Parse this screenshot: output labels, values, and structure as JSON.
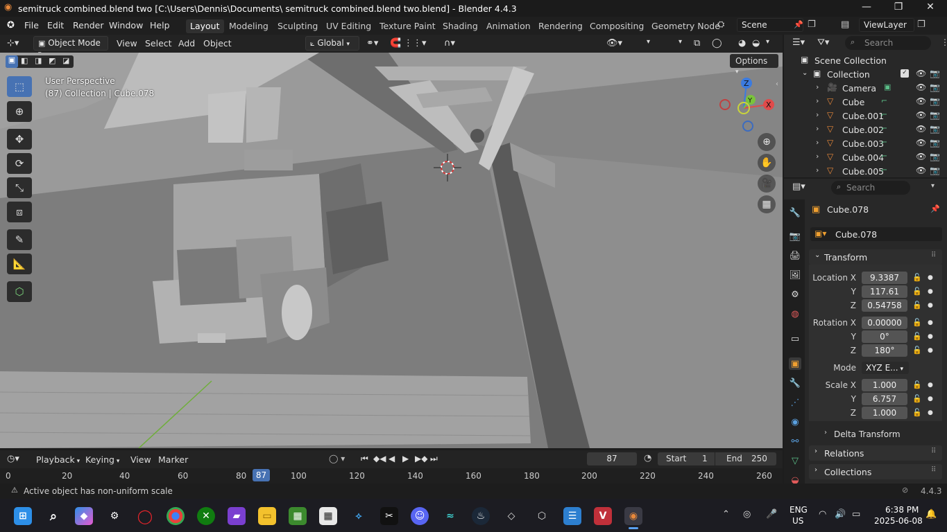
{
  "window": {
    "title": "semitruck combined.blend two [C:\\Users\\Dennis\\Documents\\ semitruck combined.blend two.blend] - Blender 4.4.3",
    "minimize": "—",
    "maximize": "❐",
    "close": "✕"
  },
  "menu": {
    "file": "File",
    "edit": "Edit",
    "render": "Render",
    "window": "Window",
    "help": "Help"
  },
  "workspaces": [
    "Layout",
    "Modeling",
    "Sculpting",
    "UV Editing",
    "Texture Paint",
    "Shading",
    "Animation",
    "Rendering",
    "Compositing",
    "Geometry Node"
  ],
  "scene": {
    "name": "Scene",
    "view_layer": "ViewLayer"
  },
  "viewport_header": {
    "mode": "Object Mode",
    "view": "View",
    "select": "Select",
    "add": "Add",
    "object": "Object",
    "orientation": "Global",
    "options": "Options"
  },
  "viewport": {
    "perspective": "User Perspective",
    "collection_info": "(87) Collection | Cube.078",
    "gizmo": {
      "z": "Z",
      "y": "Y",
      "x": "X"
    }
  },
  "outliner": {
    "search_placeholder": "Search",
    "root": "Scene Collection",
    "collection": "Collection",
    "items": [
      "Camera",
      "Cube",
      "Cube.001",
      "Cube.002",
      "Cube.003",
      "Cube.004",
      "Cube.005"
    ]
  },
  "properties": {
    "search_placeholder": "Search",
    "object_name": "Cube.078",
    "datablock_name": "Cube.078",
    "transform_title": "Transform",
    "location_label": "Location X",
    "rotation_label": "Rotation X",
    "scale_label": "Scale X",
    "y_label": "Y",
    "z_label": "Z",
    "mode_label": "Mode",
    "location": [
      "9.3387",
      "117.61",
      "0.54758"
    ],
    "rotation": [
      "0.00000",
      "0°",
      "180°"
    ],
    "mode": "XYZ E...",
    "scale": [
      "1.000",
      "6.757",
      "1.000"
    ],
    "delta_transform": "Delta Transform",
    "relations": "Relations",
    "collections": "Collections"
  },
  "timeline": {
    "playback": "Playback",
    "keying": "Keying",
    "view": "View",
    "marker": "Marker",
    "current_frame": "87",
    "start_label": "Start",
    "start": "1",
    "end_label": "End",
    "end": "250",
    "ruler": [
      "0",
      "20",
      "40",
      "60",
      "80",
      "100",
      "120",
      "140",
      "160",
      "180",
      "200",
      "220",
      "240",
      "260"
    ]
  },
  "status": {
    "message": "Active object has non-uniform scale",
    "version": "4.4.3"
  },
  "taskbar": {
    "lang": "ENG",
    "region": "US",
    "time": "6:38 PM",
    "date": "2025-06-08"
  },
  "colors": {
    "accent": "#4772b3",
    "orange": "#e8883a",
    "green_icon": "#5cc08a"
  }
}
